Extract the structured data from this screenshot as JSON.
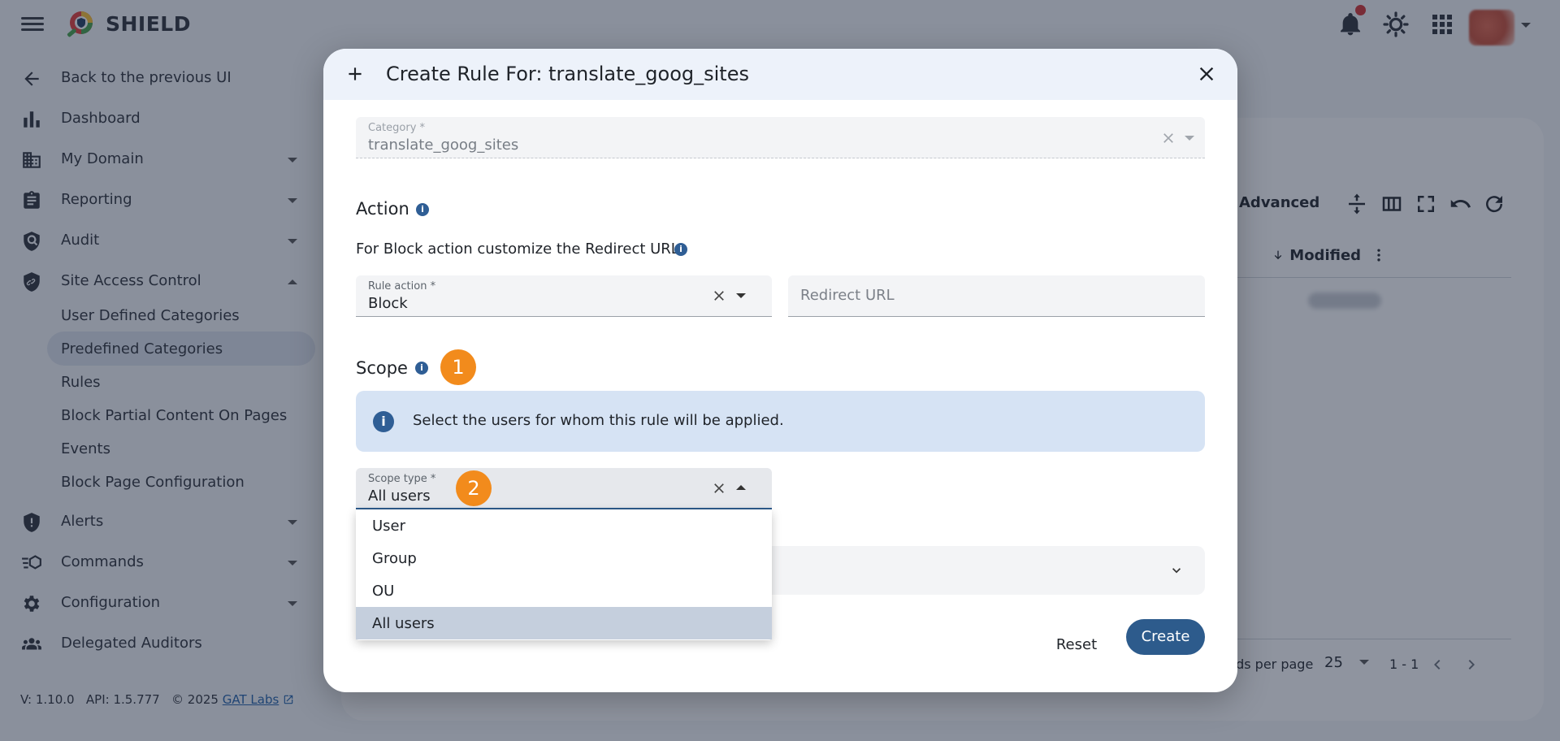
{
  "app": {
    "brand": "SHIELD"
  },
  "sidebar": {
    "items": [
      {
        "label": "Back to the previous UI",
        "icon": "arrow-left-icon"
      },
      {
        "label": "Dashboard",
        "icon": "bar-chart-icon"
      },
      {
        "label": "My Domain",
        "icon": "building-icon"
      },
      {
        "label": "Reporting",
        "icon": "clipboard-icon"
      },
      {
        "label": "Audit",
        "icon": "shield-search-icon"
      },
      {
        "label": "Site Access Control",
        "icon": "shield-link-icon"
      }
    ],
    "sub_items": [
      {
        "label": "User Defined Categories"
      },
      {
        "label": "Predefined Categories"
      },
      {
        "label": "Rules"
      },
      {
        "label": "Block Partial Content On Pages"
      },
      {
        "label": "Events"
      },
      {
        "label": "Block Page Configuration"
      }
    ],
    "items_after": [
      {
        "label": "Alerts",
        "icon": "shield-alert-icon"
      },
      {
        "label": "Commands",
        "icon": "commands-icon"
      },
      {
        "label": "Configuration",
        "icon": "gear-icon"
      },
      {
        "label": "Delegated Auditors",
        "icon": "people-icon"
      }
    ]
  },
  "footer": {
    "version": "V: 1.10.0",
    "api": "API: 1.5.777",
    "copyright": "© 2025",
    "company_link": "GAT Labs"
  },
  "background_table": {
    "advanced_label": "Advanced",
    "column_modified": "Modified",
    "records_per_page_label": "ords per page",
    "records_per_page_value": "25",
    "range": "1 - 1"
  },
  "modal": {
    "title": "Create Rule For: translate_goog_sites",
    "category": {
      "label": "Category *",
      "value": "translate_goog_sites"
    },
    "action_section": "Action",
    "redirect_hint": "For Block action customize the Redirect URL",
    "rule_action": {
      "label": "Rule action *",
      "value": "Block"
    },
    "redirect_url": {
      "placeholder": "Redirect URL"
    },
    "scope_section": "Scope",
    "scope_info": "Select the users for whom this rule will be applied.",
    "scope_type": {
      "label": "Scope type *",
      "value": "All users",
      "options": [
        "User",
        "Group",
        "OU",
        "All users"
      ],
      "selected_index": 3
    },
    "reset_label": "Reset",
    "create_label": "Create"
  },
  "badges": {
    "first": "1",
    "second": "2"
  },
  "colors": {
    "primary": "#2d5b8c",
    "badge": "#f28b1c",
    "info_bg": "#d6e3f4",
    "notification": "#d32f2f"
  }
}
